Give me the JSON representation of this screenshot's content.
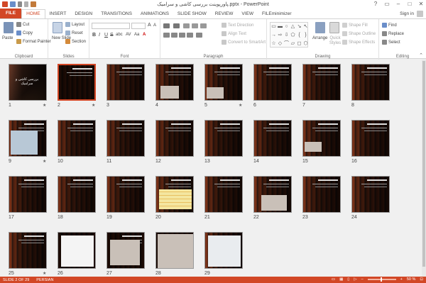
{
  "app": {
    "title": "پاورپوینت بررسی کاشی و سرامیک.pptx - PowerPoint",
    "window_controls": [
      "?",
      "▭",
      "–",
      "□",
      "✕"
    ]
  },
  "tabs": [
    "FILE",
    "HOME",
    "INSERT",
    "DESIGN",
    "TRANSITIONS",
    "ANIMATIONS",
    "SLIDE SHOW",
    "REVIEW",
    "VIEW",
    "FILEminimizer"
  ],
  "active_tab": "HOME",
  "signin": "Sign in",
  "ribbon": {
    "clipboard": {
      "label": "Clipboard",
      "paste": "Paste",
      "cut": "Cut",
      "copy": "Copy",
      "format_painter": "Format Painter"
    },
    "slides": {
      "label": "Slides",
      "new_slide": "New Slide",
      "layout": "Layout",
      "reset": "Reset",
      "section": "Section"
    },
    "font": {
      "label": "Font",
      "bold": "B",
      "italic": "I",
      "underline": "U",
      "strike": "S",
      "shadow": "abc",
      "spacing": "AV",
      "case": "Aa",
      "color": "A"
    },
    "paragraph": {
      "label": "Paragraph",
      "text_direction": "Text Direction",
      "align_text": "Align Text",
      "smartart": "Convert to SmartArt"
    },
    "drawing": {
      "label": "Drawing",
      "arrange": "Arrange",
      "quick_styles": "Quick Styles",
      "shape_fill": "Shape Fill",
      "shape_outline": "Shape Outline",
      "shape_effects": "Shape Effects"
    },
    "editing": {
      "label": "Editing",
      "find": "Find",
      "replace": "Replace",
      "select": "Select"
    }
  },
  "shapes": [
    "▭",
    "▬",
    "○",
    "△",
    "↘",
    "↖",
    "→",
    "⇨",
    "⇩",
    "⬠",
    "{",
    "}",
    "☆",
    "◇",
    "⌒",
    "▱",
    "◻",
    "⬡"
  ],
  "slides": [
    {
      "n": "1",
      "star": true
    },
    {
      "n": "2",
      "star": true,
      "selected": true
    },
    {
      "n": "3",
      "star": false
    },
    {
      "n": "4",
      "star": false
    },
    {
      "n": "5",
      "star": true
    },
    {
      "n": "6",
      "star": false
    },
    {
      "n": "7",
      "star": false
    },
    {
      "n": "8",
      "star": false
    },
    {
      "n": "9",
      "star": true
    },
    {
      "n": "10",
      "star": false
    },
    {
      "n": "11",
      "star": false
    },
    {
      "n": "12",
      "star": false
    },
    {
      "n": "13",
      "star": false
    },
    {
      "n": "14",
      "star": false
    },
    {
      "n": "15",
      "star": false
    },
    {
      "n": "16",
      "star": false
    },
    {
      "n": "17",
      "star": false
    },
    {
      "n": "18",
      "star": false
    },
    {
      "n": "19",
      "star": false
    },
    {
      "n": "20",
      "star": false
    },
    {
      "n": "21",
      "star": false
    },
    {
      "n": "22",
      "star": false
    },
    {
      "n": "23",
      "star": false
    },
    {
      "n": "24",
      "star": false
    },
    {
      "n": "25",
      "star": true
    },
    {
      "n": "26",
      "star": false
    },
    {
      "n": "27",
      "star": false
    },
    {
      "n": "28",
      "star": false
    },
    {
      "n": "29",
      "star": false
    }
  ],
  "slide1_title": "بررسی کاشی و سرامیک",
  "status": {
    "slide": "SLIDE 2 OF 29",
    "language": "PERSIAN",
    "zoom": "50 %"
  },
  "colors": {
    "accent": "#d24726"
  }
}
